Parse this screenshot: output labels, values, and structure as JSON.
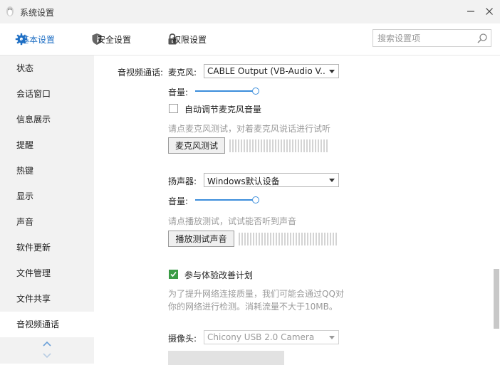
{
  "window": {
    "title": "系统设置"
  },
  "topnav": {
    "tabs": [
      {
        "label": "基本设置",
        "icon": "gear-icon"
      },
      {
        "label": "安全设置",
        "icon": "shield-icon"
      },
      {
        "label": "权限设置",
        "icon": "lock-icon"
      }
    ],
    "search_placeholder": "搜索设置项"
  },
  "sidebar": {
    "items": [
      {
        "label": "状态"
      },
      {
        "label": "会话窗口"
      },
      {
        "label": "信息展示"
      },
      {
        "label": "提醒"
      },
      {
        "label": "热键"
      },
      {
        "label": "显示"
      },
      {
        "label": "声音"
      },
      {
        "label": "软件更新"
      },
      {
        "label": "文件管理"
      },
      {
        "label": "文件共享"
      },
      {
        "label": "音视频通话"
      }
    ],
    "active": "音视频通话"
  },
  "av": {
    "section_label": "音视频通话:",
    "mic": {
      "label": "麦克风:",
      "device": "CABLE Output (VB-Audio V...",
      "volume_label": "音量:",
      "volume_level": 1.0,
      "auto_adjust_label": "自动调节麦克风音量",
      "auto_adjust_checked": false,
      "hint": "请点麦克风测试，对着麦克风说话进行试听",
      "test_button": "麦克风测试"
    },
    "speaker": {
      "label": "扬声器:",
      "device": "Windows默认设备",
      "volume_label": "音量:",
      "volume_level": 1.0,
      "hint": "请点播放测试，试试能否听到声音",
      "test_button": "播放测试声音"
    },
    "experience": {
      "label": "参与体验改善计划",
      "checked": true,
      "desc_line1": "为了提升网络连接质量，我们可能会通过QQ对",
      "desc_line2": "你的网络进行检测。消耗流量不大于10MB。"
    },
    "camera": {
      "label": "摄像头:",
      "device": "Chicony USB 2.0 Camera"
    }
  },
  "colors": {
    "accent": "#1f6fc4",
    "slider": "#3b8ddb",
    "checked": "#3a9b45",
    "sidebar_bg": "#f2f2f2"
  }
}
